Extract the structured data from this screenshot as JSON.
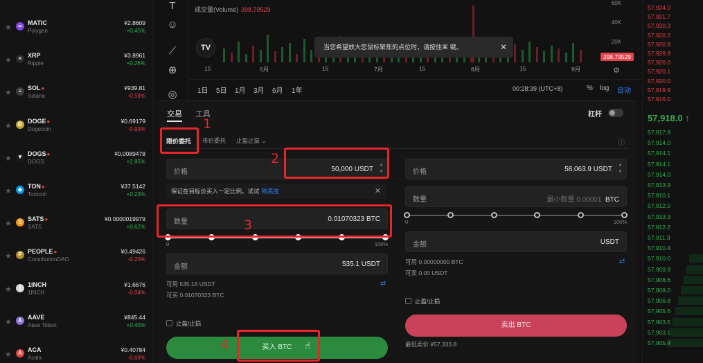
{
  "coins": [
    {
      "symbol": "MATIC",
      "name": "Polygon",
      "price": "¥2.8609",
      "change": "+0.45%",
      "dir": "pos",
      "color": "#8247e5",
      "glyph": "∞",
      "hot": false
    },
    {
      "symbol": "XRP",
      "name": "Ripple",
      "price": "¥3.8961",
      "change": "+0.26%",
      "dir": "pos",
      "color": "#2a2a2a",
      "glyph": "✕",
      "hot": false
    },
    {
      "symbol": "SOL",
      "name": "Solana",
      "price": "¥939.81",
      "change": "-0.59%",
      "dir": "neg",
      "color": "#3a3a3a",
      "glyph": "≡",
      "hot": true
    },
    {
      "symbol": "DOGE",
      "name": "Dogecoin",
      "price": "¥0.69179",
      "change": "-0.93%",
      "dir": "neg",
      "color": "#c2a633",
      "glyph": "Ð",
      "hot": true
    },
    {
      "symbol": "DOGS",
      "name": "DOGS",
      "price": "¥0.0089478",
      "change": "+2.85%",
      "dir": "pos",
      "color": "#1b1b1b",
      "glyph": "▼",
      "hot": true
    },
    {
      "symbol": "TON",
      "name": "Toncoin",
      "price": "¥37.5142",
      "change": "+0.23%",
      "dir": "pos",
      "color": "#0098ea",
      "glyph": "◆",
      "hot": true
    },
    {
      "symbol": "SATS",
      "name": "SATS",
      "price": "¥0.0000019979",
      "change": "+0.62%",
      "dir": "pos",
      "color": "#f7931a",
      "glyph": "S",
      "hot": true
    },
    {
      "symbol": "PEOPLE",
      "name": "ConstitutionDAO",
      "price": "¥0.49426",
      "change": "-0.20%",
      "dir": "neg",
      "color": "#b38b2d",
      "glyph": "P",
      "hot": true
    },
    {
      "symbol": "1INCH",
      "name": "1INCH",
      "price": "¥1.6676",
      "change": "-0.04%",
      "dir": "neg",
      "color": "#d9d9d9",
      "glyph": "1",
      "hot": false
    },
    {
      "symbol": "AAVE",
      "name": "Aave Token",
      "price": "¥845.44",
      "change": "+0.40%",
      "dir": "pos",
      "color": "#8a6fd6",
      "glyph": "A",
      "hot": false
    },
    {
      "symbol": "ACA",
      "name": "Acala",
      "price": "¥0.40784",
      "change": "-0.69%",
      "dir": "neg",
      "color": "#e0463e",
      "glyph": "A",
      "hot": false
    }
  ],
  "chart": {
    "volume_label": "成交量(Volume)",
    "volume_value": "398.79529",
    "price_ticks": [
      "60K",
      "40K",
      "20K"
    ],
    "price_badge": "398.79529",
    "date_ticks": [
      "15",
      "6月",
      "15",
      "7月",
      "15",
      "8月",
      "15",
      "9月"
    ],
    "tooltip": "当您希望放大您鼠标聚焦的点位时，请按住⌘ 键。",
    "ranges": [
      "1日",
      "5日",
      "1月",
      "3月",
      "6月",
      "1年"
    ],
    "clock": "00:28:39 (UTC+8)",
    "scale_pct": "%",
    "scale_log": "log",
    "scale_auto": "自动"
  },
  "orderbook": {
    "asks": [
      "57,924.0",
      "57,921.7",
      "57,920.3",
      "57,920.2",
      "57,920.9",
      "57,929.9",
      "57,920.0",
      "57,920.1",
      "57,920.0",
      "57,919.9",
      "57,916.0"
    ],
    "mid": "57,918.0 ↑",
    "bids": [
      "57,917.9",
      "57,914.0",
      "57,914.1",
      "57,914.1",
      "57,914.0",
      "57,913.9",
      "57,910.1",
      "57,912.0",
      "57,913.9",
      "57,912.2",
      "57,911.3",
      "57,910.4",
      "57,910.0",
      "57,909.9",
      "57,908.6",
      "57,908.0",
      "57,906.8",
      "57,905.6",
      "57,903.5",
      "57,903.1",
      "57,905.4"
    ]
  },
  "trade": {
    "tab_trade": "交易",
    "tab_tools": "工具",
    "leverage": "杠杆",
    "order_limit": "限价委托",
    "order_market": "市价委托",
    "order_stop": "止盈止损 ⌄",
    "buy": {
      "price_label": "价格",
      "price_value": "50,000 USDT",
      "notice": "保证在目标价买入一定比例。试试",
      "notice_link": "致高宝",
      "qty_label": "数量",
      "qty_value": "0.01070323 BTC",
      "slider_min": "0",
      "slider_max": "100%",
      "amount_label": "金额",
      "amount_value": "535.1 USDT",
      "available": "可用 535.16 USDT",
      "can_buy": "可买 0.01070323 BTC",
      "stop_label": "止盈/止损",
      "button": "买入 BTC",
      "percent": 100
    },
    "sell": {
      "price_label": "价格",
      "price_value": "58,063.9 USDT",
      "qty_label": "数量",
      "qty_placeholder": "最小数量 0.00001",
      "qty_unit": "BTC",
      "slider_min": "0",
      "slider_max": "100%",
      "amount_label": "金额",
      "amount_unit": "USDT",
      "available": "可用 0.00000000 BTC",
      "can_sell": "可卖 0.00 USDT",
      "stop_label": "止盈/止损",
      "button": "卖出 BTC",
      "min_sell": "最低卖价 ¥57,333.8",
      "percent": 0
    }
  },
  "annotations": [
    "1",
    "2",
    "3",
    "4"
  ]
}
